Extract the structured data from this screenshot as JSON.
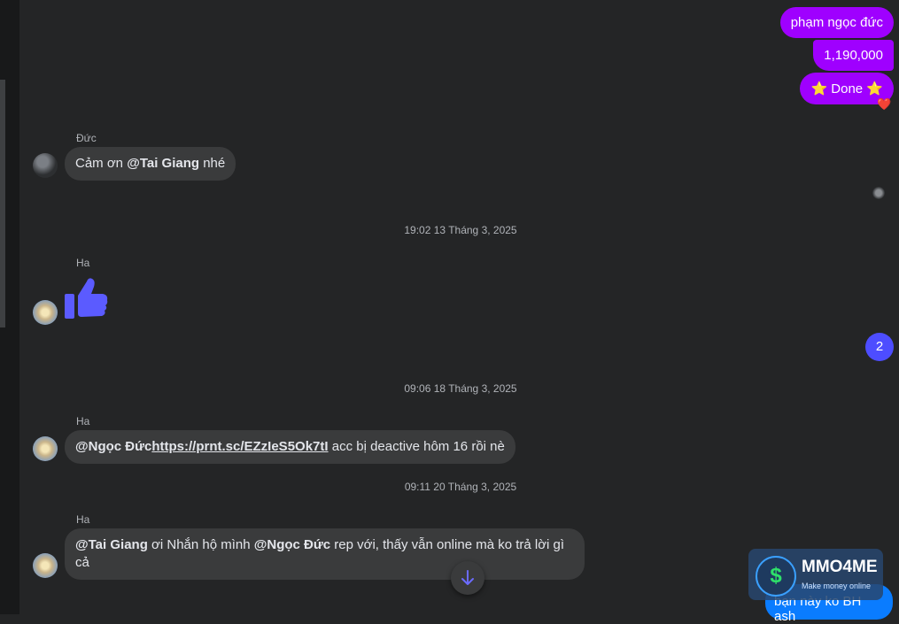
{
  "outgoing": [
    {
      "text": "phạm ngọc đức"
    },
    {
      "text": "1,190,000"
    },
    {
      "text": "⭐ Done ⭐",
      "reaction": "❤️"
    }
  ],
  "messages": [
    {
      "sender": "Đức",
      "parts": [
        {
          "mention": "@Tai Giang"
        },
        {
          "text": "  nhé"
        }
      ],
      "prefix": "Cảm ơn "
    }
  ],
  "timestamps": [
    "19:02 13 Tháng 3, 2025",
    "09:06 18 Tháng 3, 2025",
    "09:11 20 Tháng 3, 2025"
  ],
  "msg_like": {
    "sender": "Ha",
    "icon": "thumbs-up-icon"
  },
  "msg_link": {
    "sender": "Ha",
    "mention": "@Ngọc Đức",
    "link": "https://prnt.sc/EZzIeS5Ok7tI",
    "rest": " acc bị deactive hôm 16 rồi nè"
  },
  "msg_last": {
    "sender": "Ha",
    "mention1": "@Tai Giang",
    "mid": " ơi Nhắn hộ mình ",
    "mention2": "@Ngọc Đức",
    "rest": " rep  với, thấy vẫn online mà ko trả lời  gì cả"
  },
  "unread_count": "2",
  "watermark": {
    "brand": "MMO4ME",
    "tagline": "Make money online",
    "symbol": "$"
  },
  "partial_outgoing": "bạn này ko BH ash",
  "colors": {
    "outgoing": "#9f00ff",
    "incoming": "#3a3b3c",
    "background": "#242526",
    "badge": "#4d4dff",
    "like": "#5b5bff"
  }
}
